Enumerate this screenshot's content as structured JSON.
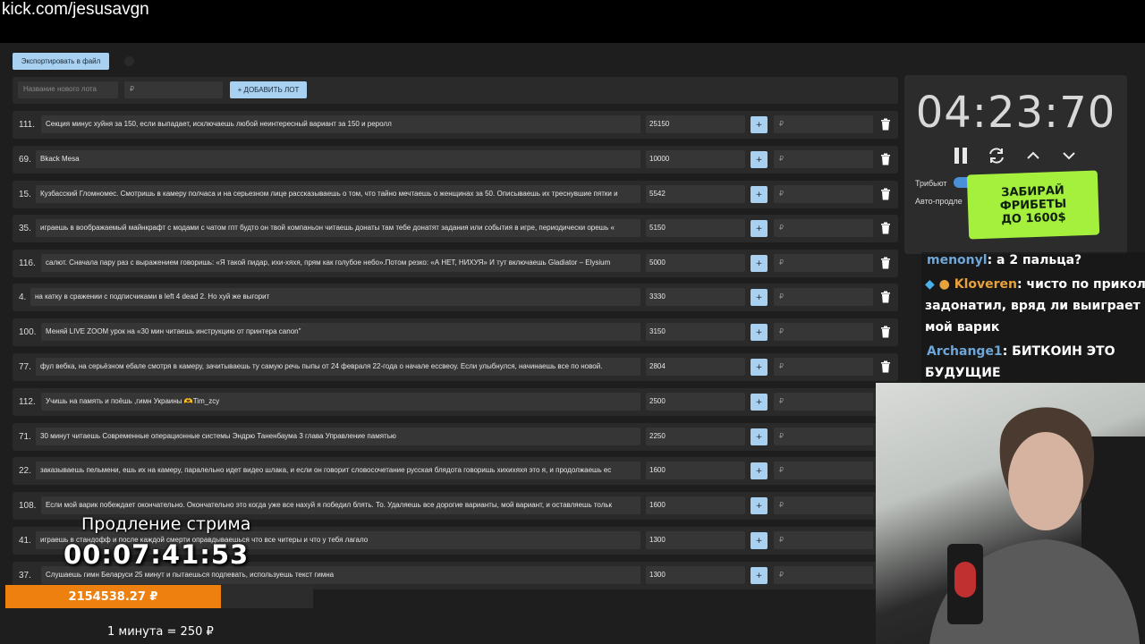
{
  "browser": {
    "url": "kick.com/jesusavgn"
  },
  "toolbar": {
    "export_label": "Экспортировать в файл"
  },
  "new_lot": {
    "name_placeholder": "Название нового лота",
    "price_placeholder": "₽",
    "add_label": "+ ДОБАВИТЬ ЛОТ"
  },
  "lots": [
    {
      "num": "111.",
      "name": "Секция минус хуйня за 150, если выпадает, исключаешь любой неинтересный вариант за 150 и реролл",
      "amount": "25150",
      "plus": "+",
      "currency": "₽"
    },
    {
      "num": "69.",
      "name": "Bkack Mesa",
      "amount": "10000",
      "plus": "+",
      "currency": "₽"
    },
    {
      "num": "15.",
      "name": "Кузбасский Гломномес. Смотришь в камеру полчаса и на серьезном лице рассказываешь о том, что тайно мечтаешь о женщинах за 50. Описываешь их треснувшие пятки и",
      "amount": "5542",
      "plus": "+",
      "currency": "₽"
    },
    {
      "num": "35.",
      "name": "играешь в воображаемый майнкрафт с модами с чатом гпт будто он твой компаньон читаешь донаты там тебе донатят задания или события в игре, периодически орешь «",
      "amount": "5150",
      "plus": "+",
      "currency": "₽"
    },
    {
      "num": "116.",
      "name": "салют. Сначала пару раз с выражением говоришь: «Я такой пидар, ихи-хяхя, прям как голубое небо».Потом резко: «А НЕТ, НИХУЯ» И тут включаешь Gladiator – Elysium",
      "amount": "5000",
      "plus": "+",
      "currency": "₽"
    },
    {
      "num": "4.",
      "name": "на катку в сражении с подписчиками в left 4 dead 2. Но хуй же выгорит",
      "amount": "3330",
      "plus": "+",
      "currency": "₽"
    },
    {
      "num": "100.",
      "name": "Меняй LIVE ZOOM урок на «30 мин читаешь инструкцию от принтера canon\"",
      "amount": "3150",
      "plus": "+",
      "currency": "₽"
    },
    {
      "num": "77.",
      "name": "фул вебка, на серьёзном ебале смотря в камеру, зачитываешь ту самую речь пыпы от 24 февраля 22-года о начале ессвеоу. Если улыбнулся, начинаешь все по новой.",
      "amount": "2804",
      "plus": "+",
      "currency": "₽"
    },
    {
      "num": "112.",
      "name": "Учишь на память и поёшь ,гимн Украины 🫶Tim_zcy",
      "amount": "2500",
      "plus": "+",
      "currency": "₽"
    },
    {
      "num": "71.",
      "name": "30 минут читаешь Современные операционные системы Эндрю Таненбаума 3 глава Управление памятью",
      "amount": "2250",
      "plus": "+",
      "currency": "₽"
    },
    {
      "num": "22.",
      "name": "заказываешь пельмени, ешь их на камеру, паралельно идет видео шлака, и если он говорит словосочетание русская блядота говоришь хихихяхя это я, и продолжаешь ес",
      "amount": "1600",
      "plus": "+",
      "currency": "₽"
    },
    {
      "num": "108.",
      "name": "Если мой варик побеждает окончательно. Окончательно это когда уже все нахуй я победил блять. То. Удаляешь все дорогие варианты, мой вариант, и оставляешь тольк",
      "amount": "1600",
      "plus": "+",
      "currency": "₽"
    },
    {
      "num": "41.",
      "name": "играешь в стандофф и после каждой смерти оправдываешься что все читеры и что у тебя лагало",
      "amount": "1300",
      "plus": "+",
      "currency": "₽"
    },
    {
      "num": "37.",
      "name": "Слушаешь гимн Беларуси 25 минут и пытаешься подпевать, используешь текст гимна",
      "amount": "1300",
      "plus": "+",
      "currency": "₽"
    }
  ],
  "timer": {
    "value": "04:23:70",
    "tribute_label": "Трибьют",
    "auto_label": "Авто-продле"
  },
  "promo": {
    "line1": "ЗАБИРАЙ",
    "line2": "ФРИБЕТЫ",
    "line3": "ДО 1600$"
  },
  "chat": [
    {
      "user": "menonyl",
      "text": ": а 2 пальца?"
    },
    {
      "user": "Kloveren",
      "text": ": чисто по приколу"
    },
    {
      "user": "",
      "text": "задонатил, вряд ли выиграет"
    },
    {
      "user": "",
      "text": "мой варик"
    },
    {
      "user": "Archange1",
      "text": ": БИТКОИН ЭТО"
    },
    {
      "user": "",
      "text": "БУДУЩИЕ"
    }
  ],
  "overlay": {
    "title": "Продление стрима",
    "clock": "00:07:41:53",
    "money": "2154538.27 ₽",
    "money_progress": 0.7,
    "rate": "1 минута = 250 ₽"
  },
  "colors": {
    "accent": "#a8d0f0",
    "money_bar": "#ee8010",
    "promo": "#a4f03c",
    "chat_user": "#6fa6d8"
  }
}
